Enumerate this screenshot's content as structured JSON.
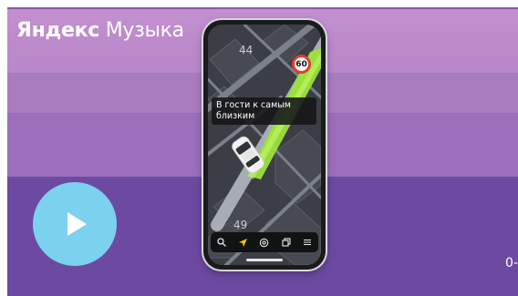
{
  "banner": {
    "brand_strong": "Яндекс",
    "brand_light": "Музыка",
    "corner_text": "0-"
  },
  "colors": {
    "band_1": "#c38fd0",
    "band_2": "#a97cc0",
    "band_3": "#9b6fbb",
    "band_4": "#6c4aa2",
    "play_button": "#7cd1ef",
    "route": "#9be33a",
    "speed_sign_border": "#e23b2e"
  },
  "phone": {
    "map": {
      "labels": [
        "44",
        "49"
      ],
      "speed_limit": "60",
      "route_color": "#9be33a"
    },
    "toast": {
      "text": "В гости к самым близким"
    },
    "bottom_bar": {
      "items": [
        {
          "icon": "search-icon"
        },
        {
          "icon": "navigation-arrow-icon"
        },
        {
          "icon": "target-icon"
        },
        {
          "icon": "copy-icon"
        },
        {
          "icon": "menu-icon"
        }
      ]
    }
  }
}
